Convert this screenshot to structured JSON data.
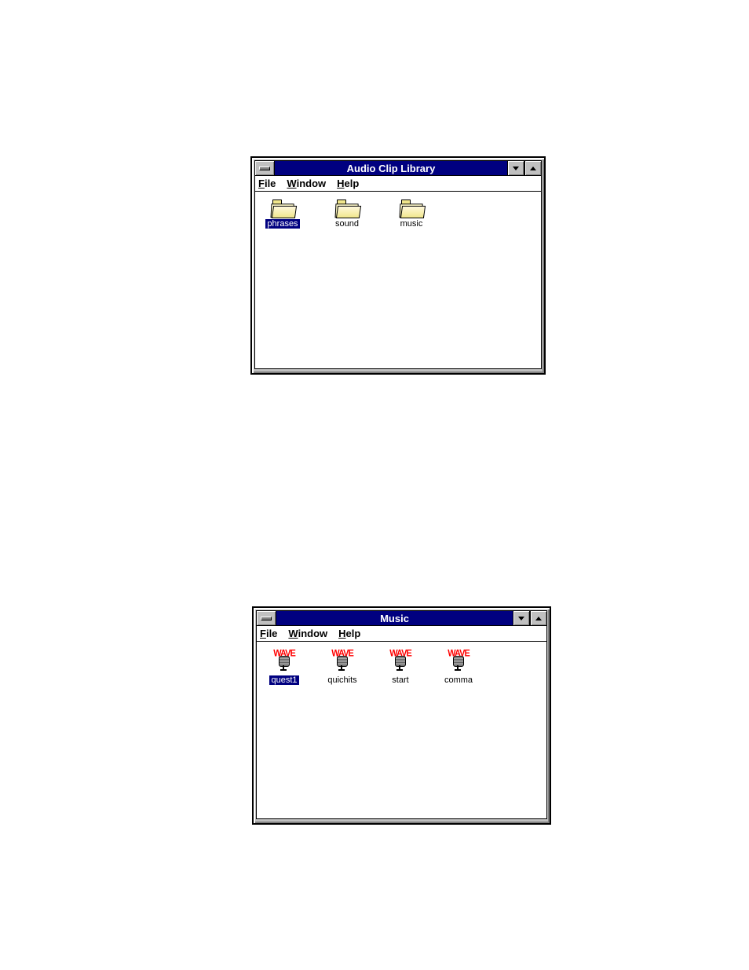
{
  "window1": {
    "title": "Audio Clip Library",
    "menu": {
      "file": "File",
      "window": "Window",
      "help": "Help"
    },
    "items": [
      {
        "label": "phrases",
        "selected": true
      },
      {
        "label": "sound",
        "selected": false
      },
      {
        "label": "music",
        "selected": false
      }
    ]
  },
  "window2": {
    "title": "Music",
    "menu": {
      "file": "File",
      "window": "Window",
      "help": "Help"
    },
    "wave_text": "WAVE",
    "items": [
      {
        "label": "quest1",
        "selected": true
      },
      {
        "label": "quichits",
        "selected": false
      },
      {
        "label": "start",
        "selected": false
      },
      {
        "label": "comma",
        "selected": false
      }
    ]
  }
}
